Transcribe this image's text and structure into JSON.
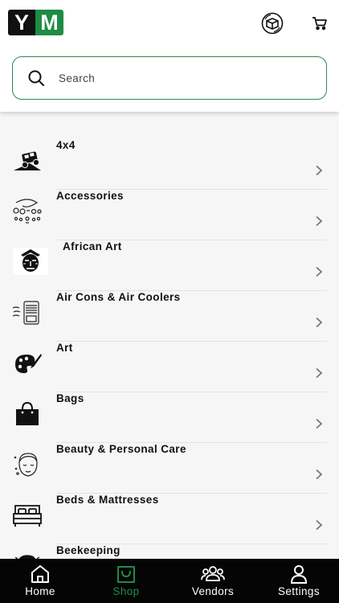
{
  "header": {
    "logo": {
      "left_letter": "Y",
      "right_letter": "M",
      "brand_color": "#1e8c45"
    },
    "box_icon": "box-3d-icon",
    "cart_icon": "cart-icon"
  },
  "search": {
    "placeholder": "Search",
    "value": ""
  },
  "categories": [
    {
      "label": "4x4",
      "icon": "4x4-vehicle-icon"
    },
    {
      "label": "Accessories",
      "icon": "accessories-icon"
    },
    {
      "label": "African Art",
      "icon": "african-mask-icon"
    },
    {
      "label": "Air Cons & Air Coolers",
      "icon": "air-cooler-icon"
    },
    {
      "label": "Art",
      "icon": "palette-icon"
    },
    {
      "label": "Bags",
      "icon": "bag-icon"
    },
    {
      "label": "Beauty & Personal Care",
      "icon": "face-care-icon"
    },
    {
      "label": "Beds & Mattresses",
      "icon": "bed-icon"
    },
    {
      "label": "Beekeeping",
      "icon": "beekeeper-icon"
    }
  ],
  "nav": {
    "items": [
      {
        "label": "Home",
        "icon": "home-icon",
        "active": false
      },
      {
        "label": "Shop",
        "icon": "shop-bag-icon",
        "active": true
      },
      {
        "label": "Vendors",
        "icon": "vendors-icon",
        "active": false
      },
      {
        "label": "Settings",
        "icon": "person-icon",
        "active": false
      }
    ],
    "active_color": "#1e8c45",
    "background": "#050505"
  }
}
